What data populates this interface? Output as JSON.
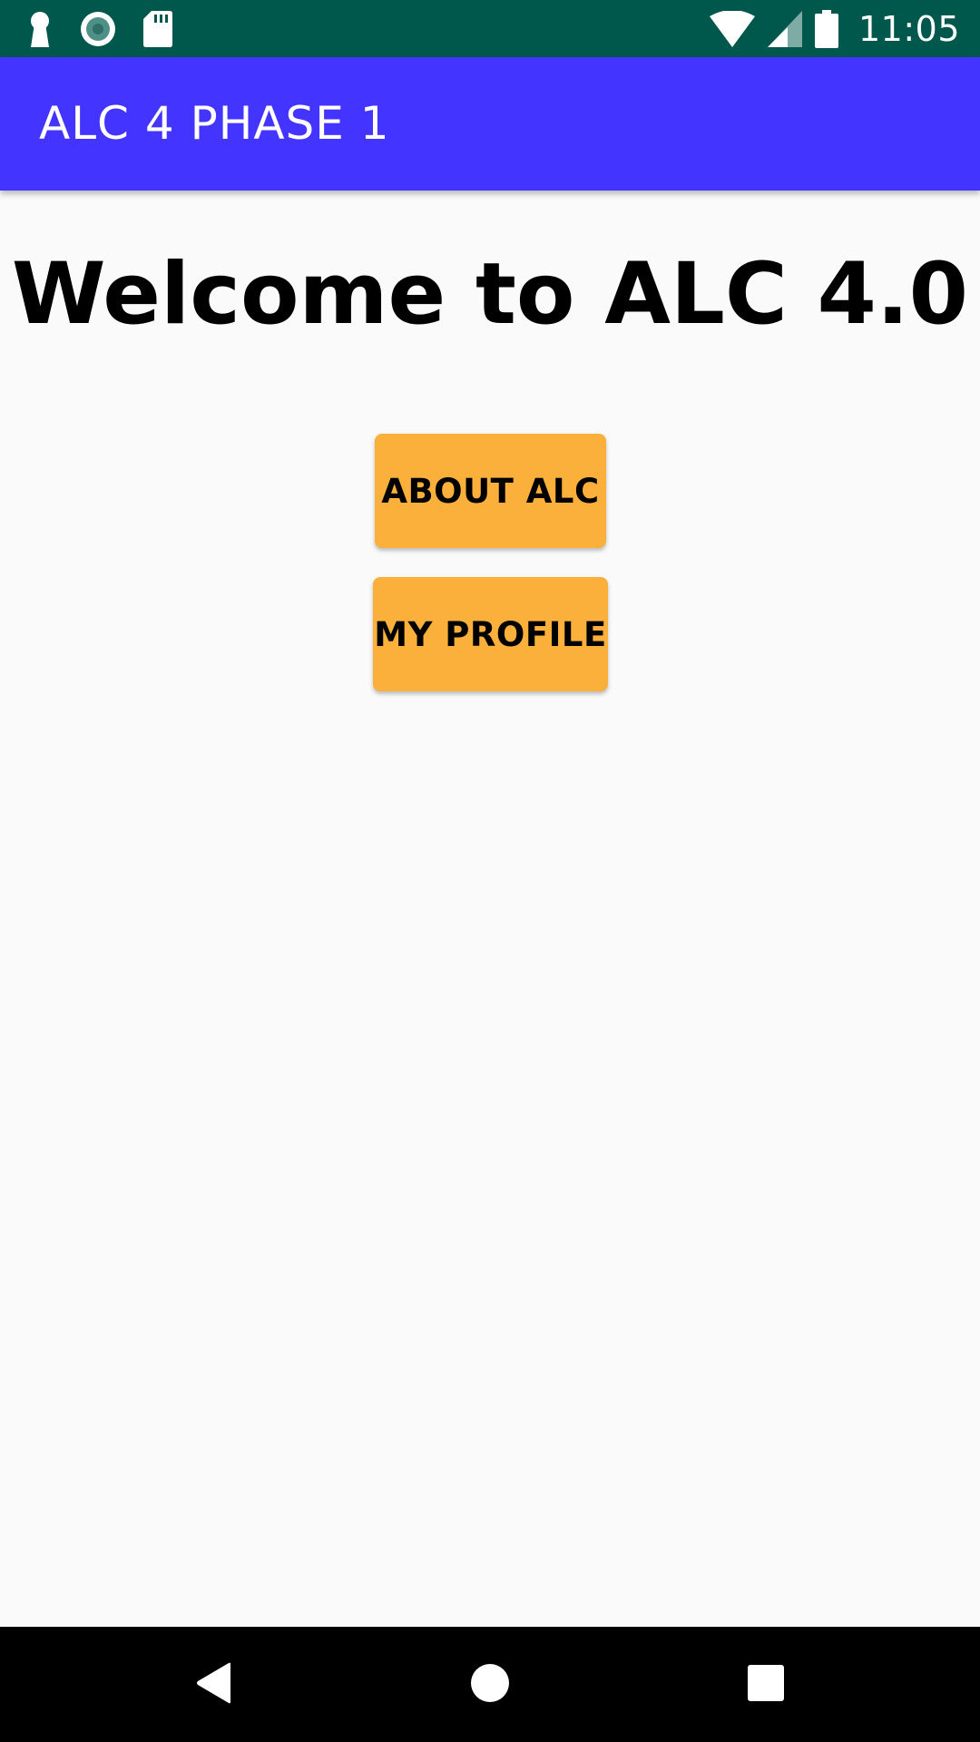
{
  "status_bar": {
    "time": "11:05",
    "left_icons": [
      "keyhole-icon",
      "record-icon",
      "sd-card-icon"
    ],
    "right_icons": [
      "wifi-icon",
      "cell-signal-icon",
      "battery-icon"
    ]
  },
  "app_bar": {
    "title": "ALC 4 PHASE 1"
  },
  "main": {
    "welcome_text": "Welcome to ALC 4.0",
    "about_button_label": "ABOUT ALC",
    "profile_button_label": "MY PROFILE"
  },
  "nav_bar": {
    "icons": [
      "back-icon",
      "home-icon",
      "recents-icon"
    ]
  },
  "colors": {
    "status_bar": "#00574B",
    "app_bar": "#4434FF",
    "background": "#FAFAFA",
    "button": "#FAB03B",
    "nav_bar": "#000000"
  }
}
